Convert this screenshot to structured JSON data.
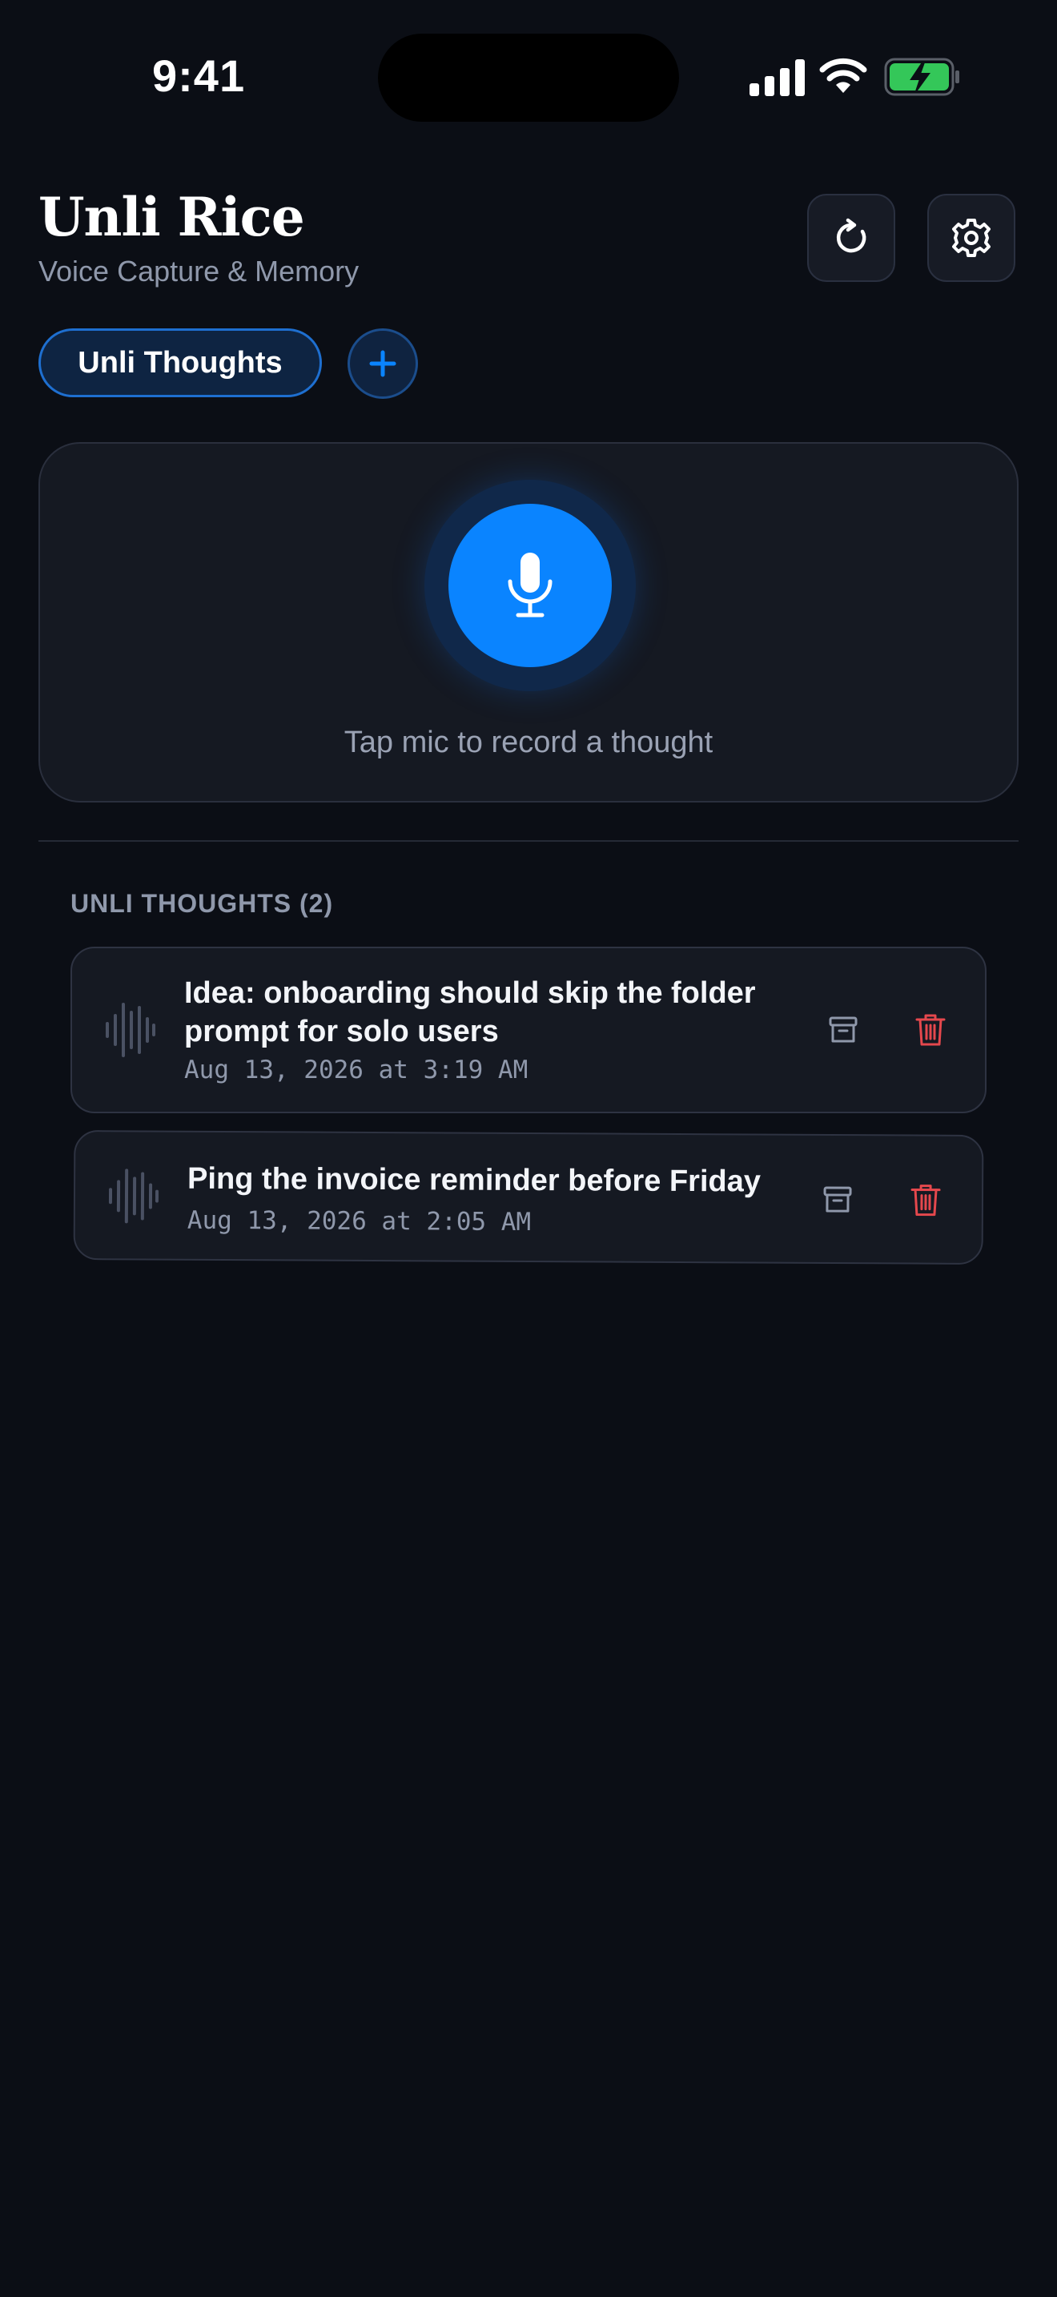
{
  "status_bar": {
    "time": "9:41",
    "icons": [
      "cellular-signal-icon",
      "wifi-icon",
      "battery-charging-icon"
    ]
  },
  "header": {
    "title": "Unli Rice",
    "subtitle": "Voice Capture & Memory",
    "refresh_icon": "refresh-icon",
    "settings_icon": "gear-icon"
  },
  "folders": {
    "active_label": "Unli Thoughts",
    "add_icon": "plus-icon"
  },
  "recorder": {
    "icon": "microphone-icon",
    "hint": "Tap mic to record a thought"
  },
  "list": {
    "section_title": "UNLI THOUGHTS (2)",
    "items": [
      {
        "title": "Idea: onboarding should skip the folder prompt for solo users",
        "date": "Aug 13, 2026 at 3:19 AM"
      },
      {
        "title": "Ping the invoice reminder before Friday",
        "date": "Aug 13, 2026 at 2:05 AM"
      }
    ]
  },
  "colors": {
    "background": "#0b0e15",
    "accent": "#0a84ff",
    "danger": "#e5484d",
    "card": "#151922",
    "battery": "#34c759"
  }
}
